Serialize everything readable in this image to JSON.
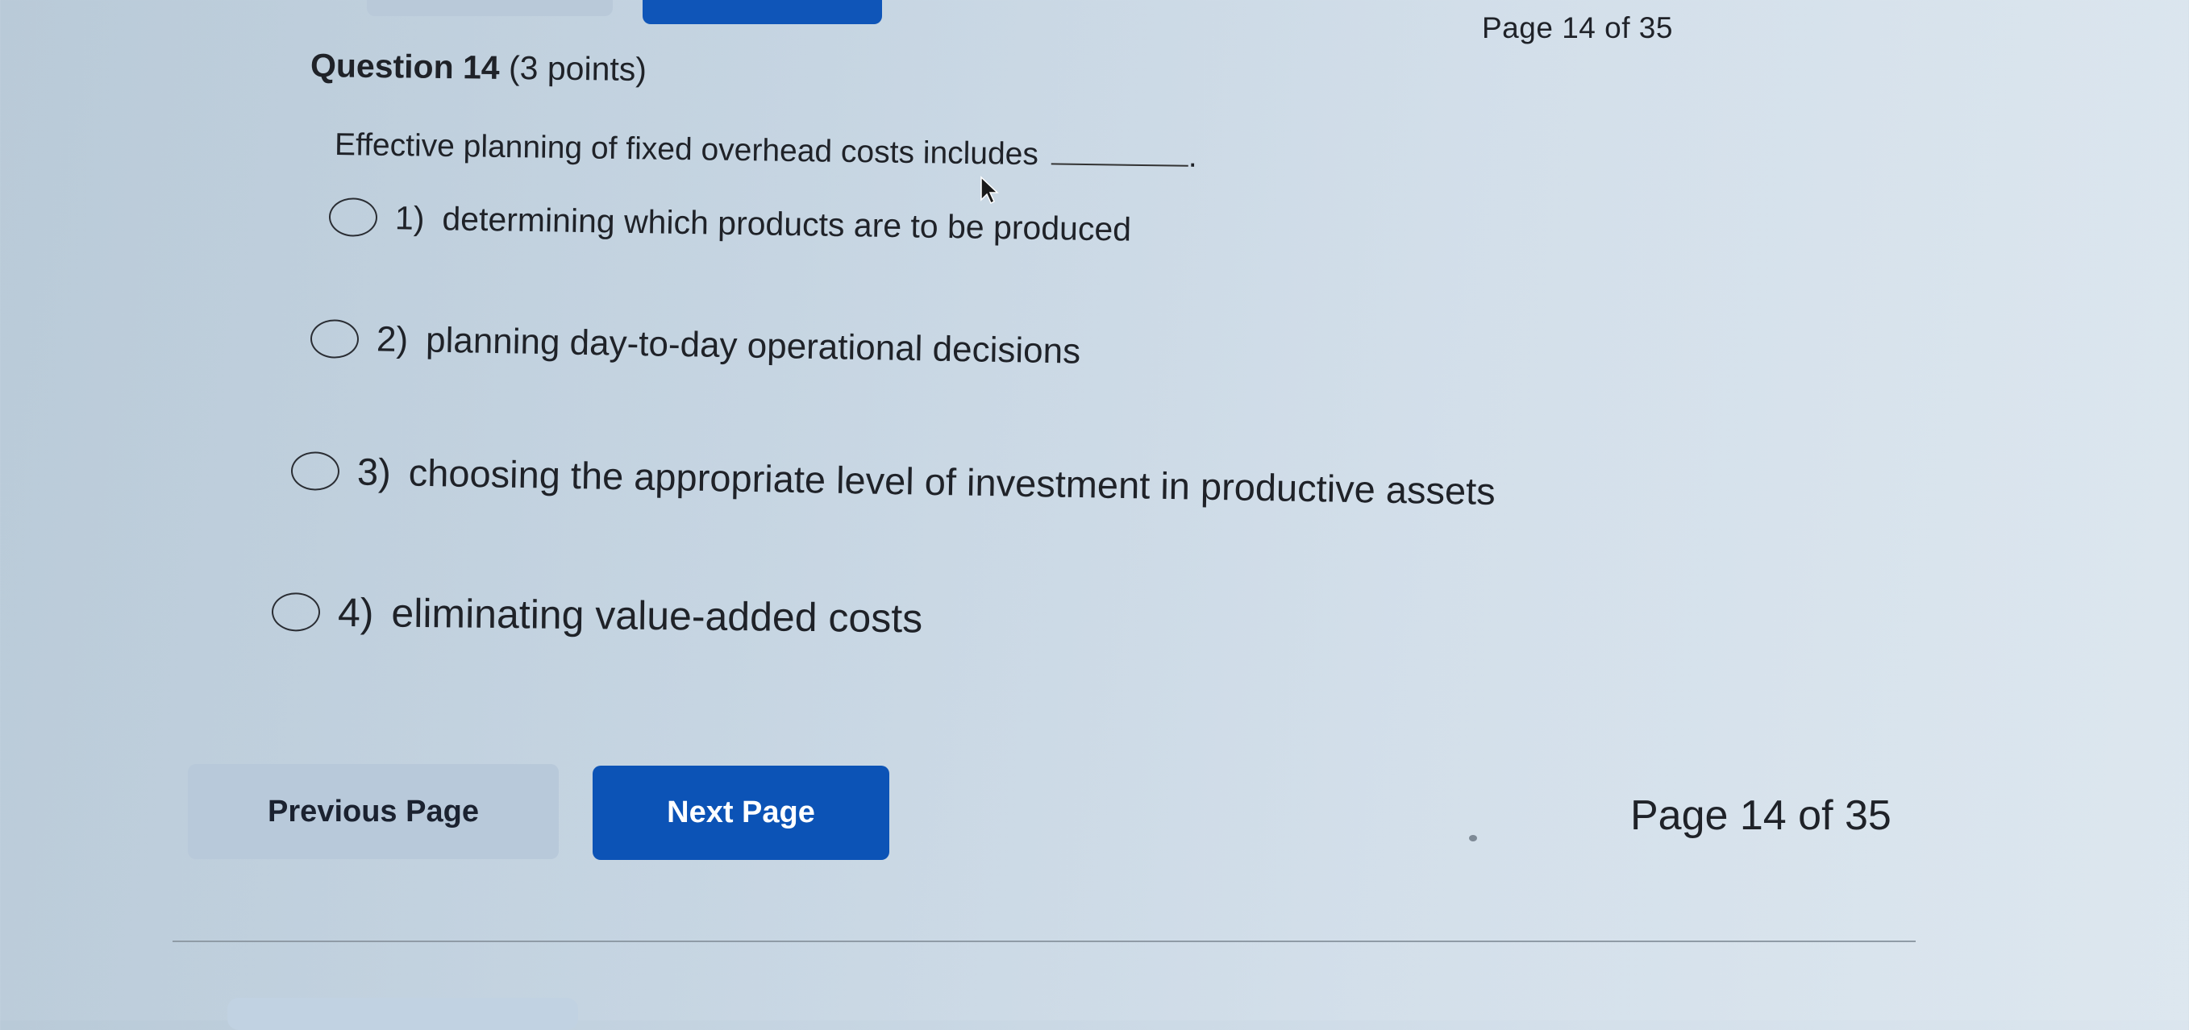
{
  "header": {
    "page_indicator": "Page 14 of 35"
  },
  "question": {
    "number_label": "Question 14",
    "points_label": "(3 points)",
    "text": "Effective planning of fixed overhead costs includes",
    "blank_end": "."
  },
  "options": [
    {
      "number": "1)",
      "text": "determining which products are to be produced"
    },
    {
      "number": "2)",
      "text": "planning day-to-day operational decisions"
    },
    {
      "number": "3)",
      "text": "choosing the appropriate level of investment in productive assets"
    },
    {
      "number": "4)",
      "text": "eliminating value-added costs"
    }
  ],
  "navigation": {
    "previous_label": "Previous Page",
    "next_label": "Next Page",
    "page_indicator": "Page 14 of 35"
  },
  "colors": {
    "primary_button": "#0c53b6",
    "secondary_button": "#b8c9da",
    "background": "#c6d5e2",
    "text": "#1f2228"
  },
  "icons": {
    "cursor": "mouse-pointer-icon",
    "radio": "radio-button-unselected"
  }
}
